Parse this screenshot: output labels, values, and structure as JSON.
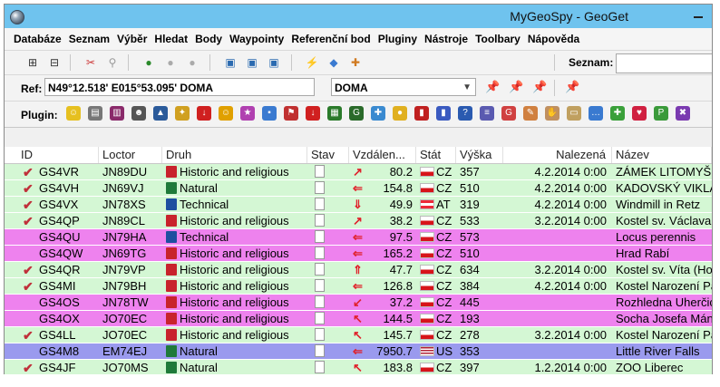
{
  "window": {
    "title": "MyGeoSpy - GeoGet"
  },
  "menu": [
    "Databáze",
    "Seznam",
    "Výběr",
    "Hledat",
    "Body",
    "Waypointy",
    "Referenční bod",
    "Pluginy",
    "Nástroje",
    "Toolbary",
    "Nápověda"
  ],
  "toolbar": {
    "seznam_label": "Seznam:"
  },
  "ref": {
    "label": "Ref:",
    "value": "N49°12.518' E015°53.095' DOMA",
    "select_value": "DOMA"
  },
  "plugin": {
    "label": "Plugin:"
  },
  "columns": [
    "ID",
    "Loctor",
    "Druh",
    "Stav",
    "Vzdálen...",
    "Stát",
    "Výška",
    "Nalezená",
    "Název"
  ],
  "colors": {
    "found": "#d4f7d4",
    "notfound": "#ee82ee",
    "selected": "#9a9aee",
    "accent": "#6fc3ee"
  },
  "rows": [
    {
      "id": "GS4VR",
      "loc": "JN89DU",
      "druh": "Historic and religious",
      "dtype": "h",
      "found": true,
      "arrow": "↗",
      "dist": "80.2",
      "country": "CZ",
      "flag": "cz",
      "alt": "357",
      "date": "4.2.2014 0:00",
      "name": "ZÁMEK LITOMYŠL",
      "bg": "found"
    },
    {
      "id": "GS4VH",
      "loc": "JN69VJ",
      "druh": "Natural",
      "dtype": "n",
      "found": true,
      "arrow": "⇐",
      "dist": "154.8",
      "country": "CZ",
      "flag": "cz",
      "alt": "510",
      "date": "4.2.2014 0:00",
      "name": "KADOVSKÝ VIKLAN",
      "bg": "found"
    },
    {
      "id": "GS4VX",
      "loc": "JN78XS",
      "druh": "Technical",
      "dtype": "t",
      "found": true,
      "arrow": "⇓",
      "dist": "49.9",
      "country": "AT",
      "flag": "at",
      "alt": "319",
      "date": "4.2.2014 0:00",
      "name": "Windmill in Retz",
      "bg": "found"
    },
    {
      "id": "GS4QP",
      "loc": "JN89CL",
      "druh": "Historic and religious",
      "dtype": "h",
      "found": true,
      "arrow": "↗",
      "dist": "38.2",
      "country": "CZ",
      "flag": "cz",
      "alt": "533",
      "date": "3.2.2014 0:00",
      "name": "Kostel sv. Václava",
      "bg": "found"
    },
    {
      "id": "GS4QU",
      "loc": "JN79HA",
      "druh": "Technical",
      "dtype": "t",
      "found": false,
      "arrow": "⇐",
      "dist": "97.5",
      "country": "CZ",
      "flag": "cz",
      "alt": "573",
      "date": "",
      "name": "Locus perennis",
      "bg": "notfound"
    },
    {
      "id": "GS4QW",
      "loc": "JN69TG",
      "druh": "Historic and religious",
      "dtype": "h",
      "found": false,
      "arrow": "⇐",
      "dist": "165.2",
      "country": "CZ",
      "flag": "cz",
      "alt": "510",
      "date": "",
      "name": "Hrad Rabí",
      "bg": "notfound"
    },
    {
      "id": "GS4QR",
      "loc": "JN79VP",
      "druh": "Historic and religious",
      "dtype": "h",
      "found": true,
      "arrow": "⇑",
      "dist": "47.7",
      "country": "CZ",
      "flag": "cz",
      "alt": "634",
      "date": "3.2.2014 0:00",
      "name": "Kostel sv. Víta (Hodice)",
      "bg": "found"
    },
    {
      "id": "GS4MI",
      "loc": "JN79BH",
      "druh": "Historic and religious",
      "dtype": "h",
      "found": true,
      "arrow": "⇐",
      "dist": "126.8",
      "country": "CZ",
      "flag": "cz",
      "alt": "384",
      "date": "4.2.2014 0:00",
      "name": "Kostel Narození Páně",
      "bg": "found"
    },
    {
      "id": "GS4OS",
      "loc": "JN78TW",
      "druh": "Historic and religious",
      "dtype": "h",
      "found": false,
      "arrow": "↙",
      "dist": "37.2",
      "country": "CZ",
      "flag": "cz",
      "alt": "445",
      "date": "",
      "name": "Rozhledna Uherčice",
      "bg": "notfound"
    },
    {
      "id": "GS4OX",
      "loc": "JO70EC",
      "druh": "Historic and religious",
      "dtype": "h",
      "found": false,
      "arrow": "↖",
      "dist": "144.5",
      "country": "CZ",
      "flag": "cz",
      "alt": "193",
      "date": "",
      "name": "Socha Josefa Mánesa",
      "bg": "notfound"
    },
    {
      "id": "GS4LL",
      "loc": "JO70EC",
      "druh": "Historic and religious",
      "dtype": "h",
      "found": true,
      "arrow": "↖",
      "dist": "145.7",
      "country": "CZ",
      "flag": "cz",
      "alt": "278",
      "date": "3.2.2014 0:00",
      "name": "Kostel Narození Páně",
      "bg": "found"
    },
    {
      "id": "GS4M8",
      "loc": "EM74EJ",
      "druh": "Natural",
      "dtype": "n",
      "found": false,
      "arrow": "⇐",
      "dist": "7950.7",
      "country": "US",
      "flag": "us",
      "alt": "353",
      "date": "",
      "name": "Little River Falls",
      "bg": "selected"
    },
    {
      "id": "GS4JF",
      "loc": "JO70MS",
      "druh": "Natural",
      "dtype": "n",
      "found": true,
      "arrow": "↖",
      "dist": "183.8",
      "country": "CZ",
      "flag": "cz",
      "alt": "397",
      "date": "1.2.2014 0:00",
      "name": "ZOO Liberec",
      "bg": "found"
    }
  ]
}
